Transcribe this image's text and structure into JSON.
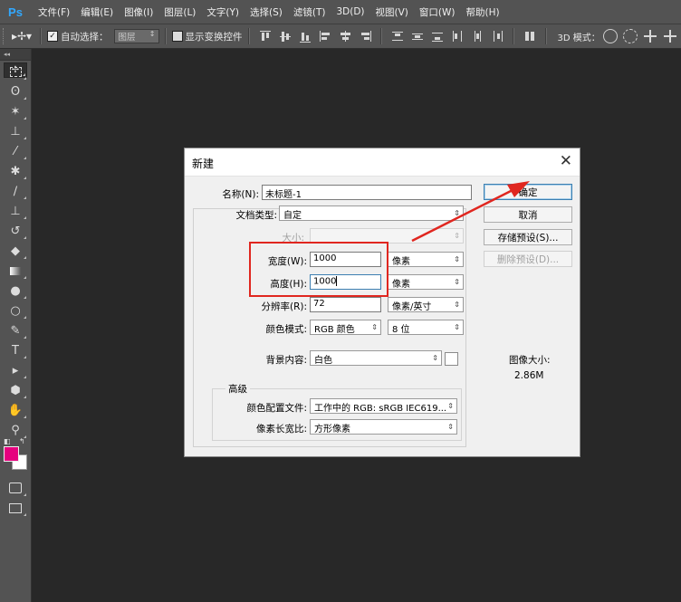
{
  "menubar": {
    "logo": "Ps",
    "items": [
      "文件(F)",
      "编辑(E)",
      "图像(I)",
      "图层(L)",
      "文字(Y)",
      "选择(S)",
      "滤镜(T)",
      "3D(D)",
      "视图(V)",
      "窗口(W)",
      "帮助(H)"
    ]
  },
  "options": {
    "auto_select_label": "自动选择：",
    "auto_select_value": "图层",
    "show_transform_label": "显示变换控件",
    "mode_3d_label": "3D 模式："
  },
  "dialog": {
    "title": "新建",
    "name_label": "名称(N):",
    "name_value": "未标题-1",
    "doc_type_label": "文档类型:",
    "doc_type_value": "自定",
    "size_label": "大小:",
    "size_value": "",
    "width_label": "宽度(W):",
    "width_value": "1000",
    "width_unit": "像素",
    "height_label": "高度(H):",
    "height_value": "1000",
    "height_unit": "像素",
    "resolution_label": "分辨率(R):",
    "resolution_value": "72",
    "resolution_unit": "像素/英寸",
    "color_mode_label": "颜色模式:",
    "color_mode_value": "RGB 颜色",
    "bit_depth_value": "8 位",
    "background_label": "背景内容:",
    "background_value": "白色",
    "advanced_label": "高级",
    "color_profile_label": "颜色配置文件:",
    "color_profile_value": "工作中的 RGB: sRGB IEC619...",
    "pixel_aspect_label": "像素长宽比:",
    "pixel_aspect_value": "方形像素",
    "ok_button": "确定",
    "cancel_button": "取消",
    "save_preset_button": "存储预设(S)...",
    "delete_preset_button": "删除预设(D)...",
    "image_size_label": "图像大小:",
    "image_size_value": "2.86M"
  },
  "colors": {
    "foreground": "#e6007e",
    "background": "#ffffff",
    "annotation": "#e0261f"
  }
}
